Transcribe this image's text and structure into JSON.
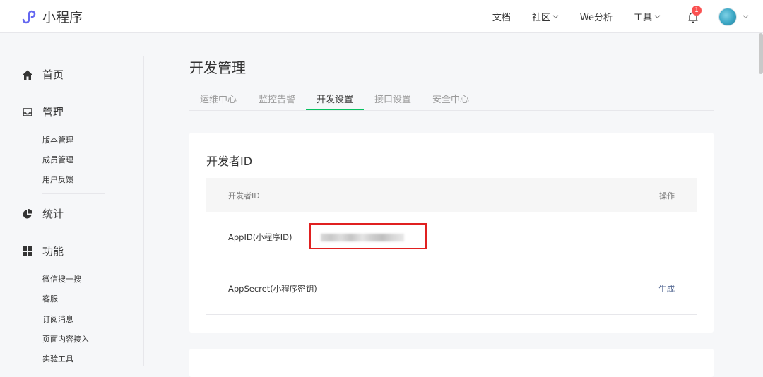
{
  "header": {
    "logo_text": "小程序",
    "nav": {
      "docs": "文档",
      "community": "社区",
      "analysis": "We分析",
      "tools": "工具"
    },
    "notification_count": "1"
  },
  "sidebar": {
    "home": "首页",
    "manage": "管理",
    "manage_items": [
      "版本管理",
      "成员管理",
      "用户反馈"
    ],
    "stats": "统计",
    "features": "功能",
    "feature_items": [
      "微信搜一搜",
      "客服",
      "订阅消息",
      "页面内容接入",
      "实验工具"
    ]
  },
  "main": {
    "title": "开发管理",
    "tabs": [
      "运维中心",
      "监控告警",
      "开发设置",
      "接口设置",
      "安全中心"
    ],
    "active_tab": "开发设置",
    "card": {
      "title": "开发者ID",
      "col_id": "开发者ID",
      "col_action": "操作",
      "rows": [
        {
          "label": "AppID(小程序ID)"
        },
        {
          "label": "AppSecret(小程序密钥)",
          "action": "生成"
        }
      ]
    }
  },
  "colors": {
    "accent_green": "#07c160",
    "link_blue": "#576b95",
    "highlight_red": "#e02020",
    "badge_red": "#fa5151"
  }
}
